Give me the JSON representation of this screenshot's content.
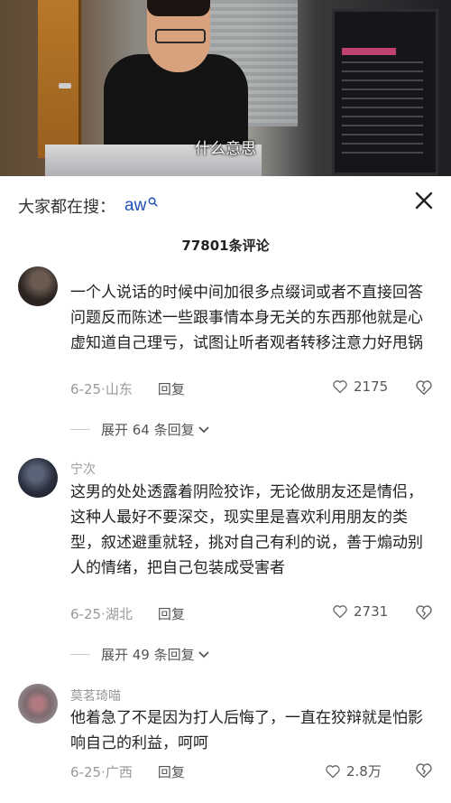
{
  "video": {
    "caption": "什么意思"
  },
  "search": {
    "prefix": "大家都在搜：",
    "term": "aw"
  },
  "comments_header": {
    "count_label": "77801条评论"
  },
  "comments": [
    {
      "username": "",
      "text": "一个人说话的时候中间加很多点缀词或者不直接回答问题反而陈述一些跟事情本身无关的东西那他就是心虚知道自己理亏，试图让听者观者转移注意力好甩锅",
      "date": "6-25",
      "location": "山东",
      "reply_label": "回复",
      "likes": "2175",
      "expand_label": "展开 64 条回复"
    },
    {
      "username": "宁次",
      "text": "这男的处处透露着阴险狡诈，无论做朋友还是情侣，这种人最好不要深交，现实里是喜欢利用朋友的类型，叙述避重就轻，挑对自己有利的说，善于煽动别人的情绪，把自己包装成受害者",
      "date": "6-25",
      "location": "湖北",
      "reply_label": "回复",
      "likes": "2731",
      "expand_label": "展开 49 条回复"
    },
    {
      "username": "莫茗琦喵",
      "text": "他着急了不是因为打人后悔了，一直在狡辩就是怕影响自己的利益，呵呵",
      "date": "6-25",
      "location": "广西",
      "reply_label": "回复",
      "likes": "2.8万"
    }
  ],
  "icons": {
    "close": "close-icon",
    "search": "search-icon",
    "like": "heart-icon",
    "dislike": "broken-heart-icon",
    "expand": "chevron-down-icon"
  },
  "colors": {
    "search_term": "#1f4fb3",
    "muted": "#999999",
    "text": "#222222"
  }
}
